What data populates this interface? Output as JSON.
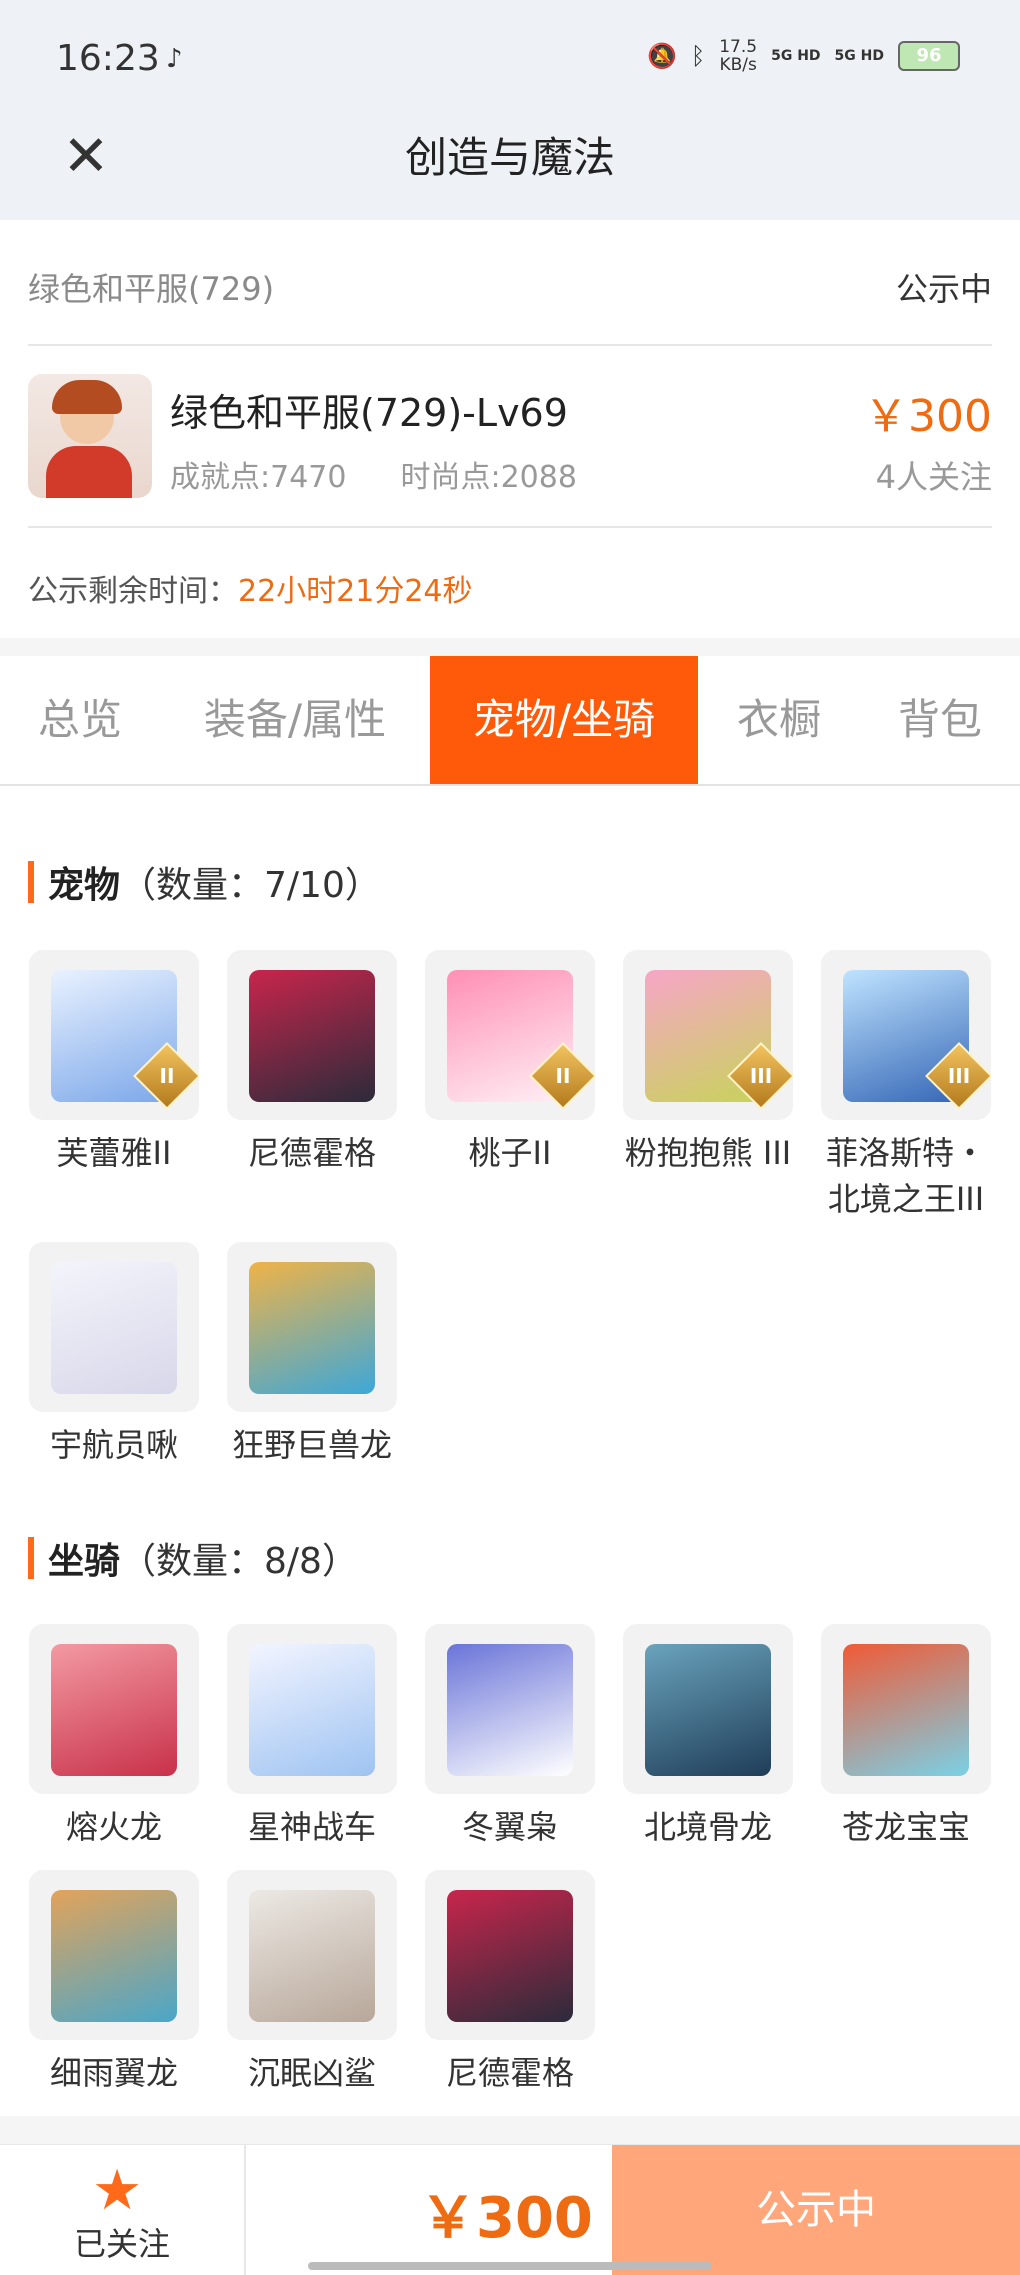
{
  "status_bar": {
    "time": "16:23",
    "speed_value": "17.5",
    "speed_unit": "KB/s",
    "net1": "5G HD",
    "net2": "5G HD",
    "battery": "96"
  },
  "header": {
    "title": "创造与魔法"
  },
  "listing": {
    "server": "绿色和平服(729)",
    "status": "公示中",
    "char_name": "绿色和平服(729)-Lv69",
    "price": "￥300",
    "achievement": "成就点:7470",
    "fashion": "时尚点:2088",
    "followers": "4人关注",
    "remain_label": "公示剩余时间：",
    "remain_value": "22小时21分24秒"
  },
  "tabs": [
    {
      "label": "总览"
    },
    {
      "label": "装备/属性"
    },
    {
      "label": "宠物/坐骑"
    },
    {
      "label": "衣橱"
    },
    {
      "label": "背包"
    }
  ],
  "pets": {
    "title": "宠物",
    "count": "（数量：7/10）",
    "items": [
      {
        "name": "芙蕾雅II",
        "badge": "II",
        "color_a": "#e9f2ff",
        "color_b": "#7ba7e9"
      },
      {
        "name": "尼德霍格",
        "badge": "",
        "color_a": "#2b2b3a",
        "color_b": "#c8254c"
      },
      {
        "name": "桃子II",
        "badge": "II",
        "color_a": "#fff0f6",
        "color_b": "#ff8fb5"
      },
      {
        "name": "粉抱抱熊 III",
        "badge": "III",
        "color_a": "#f7a6c7",
        "color_b": "#c7d35a"
      },
      {
        "name": "菲洛斯特・北境之王III",
        "badge": "III",
        "color_a": "#bfe3ff",
        "color_b": "#3466b5"
      },
      {
        "name": "宇航员啾",
        "badge": "",
        "color_a": "#f4f4fb",
        "color_b": "#d7d7ea"
      },
      {
        "name": "狂野巨兽龙",
        "badge": "",
        "color_a": "#f0b347",
        "color_b": "#3da7d9"
      }
    ]
  },
  "mounts": {
    "title": "坐骑",
    "count": "（数量：8/8）",
    "items": [
      {
        "name": "熔火龙",
        "color_a": "#f39aa2",
        "color_b": "#c8314a"
      },
      {
        "name": "星神战车",
        "color_a": "#f3f5ff",
        "color_b": "#9ec3f2"
      },
      {
        "name": "冬翼枭",
        "color_a": "#ffffff",
        "color_b": "#6a74d8"
      },
      {
        "name": "北境骨龙",
        "color_a": "#6aa3bd",
        "color_b": "#1f3d58"
      },
      {
        "name": "苍龙宝宝",
        "color_a": "#f05a36",
        "color_b": "#7ad1e6"
      },
      {
        "name": "细雨翼龙",
        "color_a": "#e2a35a",
        "color_b": "#4aa6c9"
      },
      {
        "name": "沉眠凶鲨",
        "color_a": "#ece9e4",
        "color_b": "#b8a79a"
      },
      {
        "name": "尼德霍格",
        "color_a": "#2b2b3a",
        "color_b": "#c8254c"
      }
    ]
  },
  "bottom": {
    "follow_label": "已关注",
    "price": "￥300",
    "status": "公示中"
  }
}
